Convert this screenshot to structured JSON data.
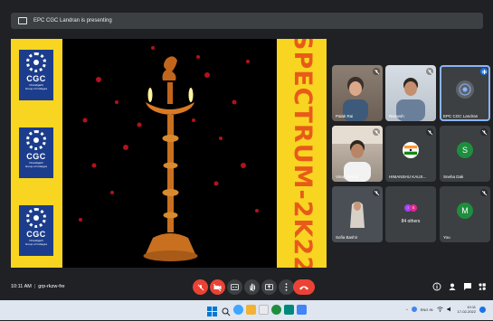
{
  "present_bar": {
    "text": "EPC CGC Landran is presenting"
  },
  "slide": {
    "logo_text": "CGC",
    "logo_sub_1": "Chandigarh",
    "logo_sub_2": "Group of Colleges",
    "banner": "SPECTRUM-2K22"
  },
  "participants": [
    {
      "name": "Palak Rai"
    },
    {
      "name": "Ramesh"
    },
    {
      "name": "EPC CGC Landran"
    },
    {
      "name": "Vinay Bhatia"
    },
    {
      "name": "HIMANSHU KAUS..."
    },
    {
      "name": "Sneha Dak",
      "initial": "S"
    },
    {
      "name": "Sofia Bashir"
    },
    {
      "name": "",
      "others_label": "84 others",
      "mini": [
        "I",
        "S"
      ]
    },
    {
      "name": "You",
      "initial": "M"
    }
  ],
  "meeting": {
    "time": "10:11 AM",
    "separator": "|",
    "code": "grp-rkzw-fre"
  },
  "taskbar": {
    "lang": "ENG IN",
    "time": "10:11",
    "date": "17-02-2022"
  },
  "colors": {
    "accent": "#8ab4f8",
    "danger": "#ea4335",
    "banner": "#f7d521",
    "banner_text": "#e85a1a",
    "sneha_avatar": "#1e8e3e",
    "you_avatar": "#1e8e3e"
  }
}
